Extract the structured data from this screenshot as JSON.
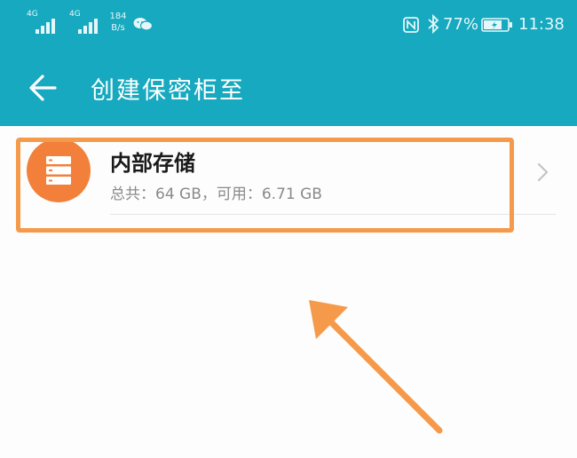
{
  "status_bar": {
    "sim1_tag": "4G",
    "sim2_tag": "4G",
    "net_speed_value": "184",
    "net_speed_unit": "B/s",
    "battery": "77%",
    "time": "11:38",
    "icons": [
      "signal-icon",
      "wechat-icon",
      "nfc-icon",
      "bluetooth-icon",
      "battery-icon"
    ]
  },
  "header": {
    "title": "创建保密柜至",
    "back_icon": "arrow-left-icon"
  },
  "storage_list": [
    {
      "title": "内部存储",
      "subtitle": "总共：64 GB，可用：6.71 GB",
      "icon": "storage-icon"
    }
  ],
  "colors": {
    "appbar": "#16a9bf",
    "storage_icon_bg": "#f2803b",
    "annotation": "#f59a4a"
  }
}
